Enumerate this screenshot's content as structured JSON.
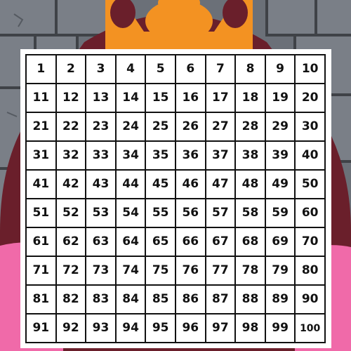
{
  "board": {
    "title": "",
    "numbers": [
      1,
      2,
      3,
      4,
      5,
      6,
      7,
      8,
      9,
      10,
      11,
      12,
      13,
      14,
      15,
      16,
      17,
      18,
      19,
      20,
      21,
      22,
      23,
      24,
      25,
      26,
      27,
      28,
      29,
      30,
      31,
      32,
      33,
      34,
      35,
      36,
      37,
      38,
      39,
      40,
      41,
      42,
      43,
      44,
      45,
      46,
      47,
      48,
      49,
      50,
      51,
      52,
      53,
      54,
      55,
      56,
      57,
      58,
      59,
      60,
      61,
      62,
      63,
      64,
      65,
      66,
      67,
      68,
      69,
      70,
      71,
      72,
      73,
      74,
      75,
      76,
      77,
      78,
      79,
      80,
      81,
      82,
      83,
      84,
      85,
      86,
      87,
      88,
      89,
      90,
      91,
      92,
      93,
      94,
      95,
      96,
      97,
      98,
      99,
      100
    ],
    "columns": 10,
    "rows": 10
  },
  "theme": {
    "wall_color": "#6b7078",
    "robe_color": "#6a1f2b",
    "crown_color": "#f39222",
    "collar_color": "#f06aa9",
    "grid_line_color": "#111111"
  }
}
